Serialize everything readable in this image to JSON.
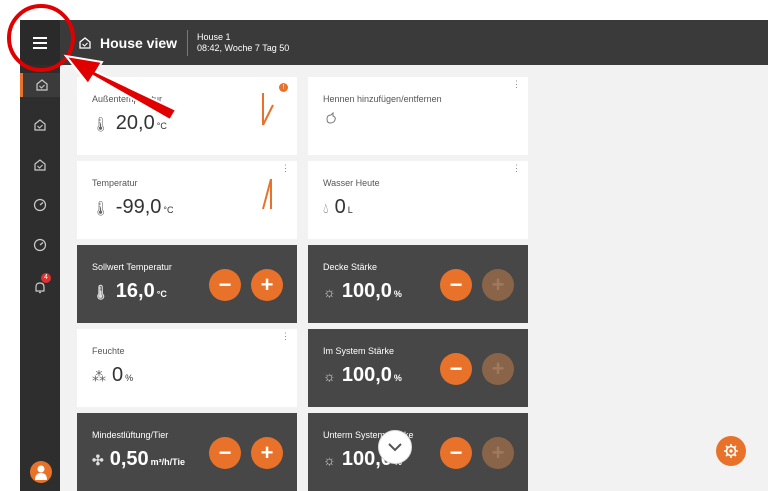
{
  "header": {
    "menu_icon": "hamburger-icon",
    "home_icon": "house-icon",
    "title": "House view",
    "house_name": "House 1",
    "time_info": "08:42, Woche 7 Tag 50"
  },
  "sidebar": {
    "items": [
      {
        "icon": "house-icon",
        "active": true
      },
      {
        "icon": "house-icon",
        "active": false
      },
      {
        "icon": "house-icon",
        "active": false
      },
      {
        "icon": "gauge-icon",
        "active": false
      },
      {
        "icon": "gauge-icon",
        "active": false
      },
      {
        "icon": "bell-icon",
        "badge": "4"
      }
    ],
    "avatar_icon": "farmer-avatar-icon"
  },
  "tiles": [
    {
      "label": "Außentemperatur",
      "value": "20,0",
      "unit": "°C",
      "icon": "thermometer-icon",
      "warning": "!"
    },
    {
      "label": "Hennen hinzufügen/entfernen",
      "icon": "hen-icon"
    },
    {
      "label": "Temperatur",
      "value": "-99,0",
      "unit": "°C",
      "icon": "thermometer-icon"
    },
    {
      "label": "Wasser Heute",
      "value": "0",
      "unit": "L",
      "icon": "water-drop-icon"
    },
    {
      "label": "Sollwert Temperatur",
      "value": "16,0",
      "unit": "°C",
      "icon": "thermometer-icon"
    },
    {
      "label": "Decke Stärke",
      "value": "100,0",
      "unit": "%",
      "icon": "light-bulb-icon"
    },
    {
      "label": "Feuchte",
      "value": "0",
      "unit": "%",
      "icon": "humidity-icon"
    },
    {
      "label": "Im System Stärke",
      "value": "100,0",
      "unit": "%",
      "icon": "light-bulb-icon"
    },
    {
      "label": "Mindestlüftung/Tier",
      "value": "0,50",
      "unit": "m³/h/Tie",
      "icon": "fan-icon"
    },
    {
      "label": "Unterm System Stärke",
      "value": "100,0",
      "unit": "%",
      "icon": "light-bulb-icon"
    }
  ],
  "buttons": {
    "minus": "−",
    "plus": "+"
  },
  "colors": {
    "accent": "#e8722a",
    "annotation": "#e00000",
    "dark_tile": "#474747",
    "topbar": "#3a3a3a"
  }
}
